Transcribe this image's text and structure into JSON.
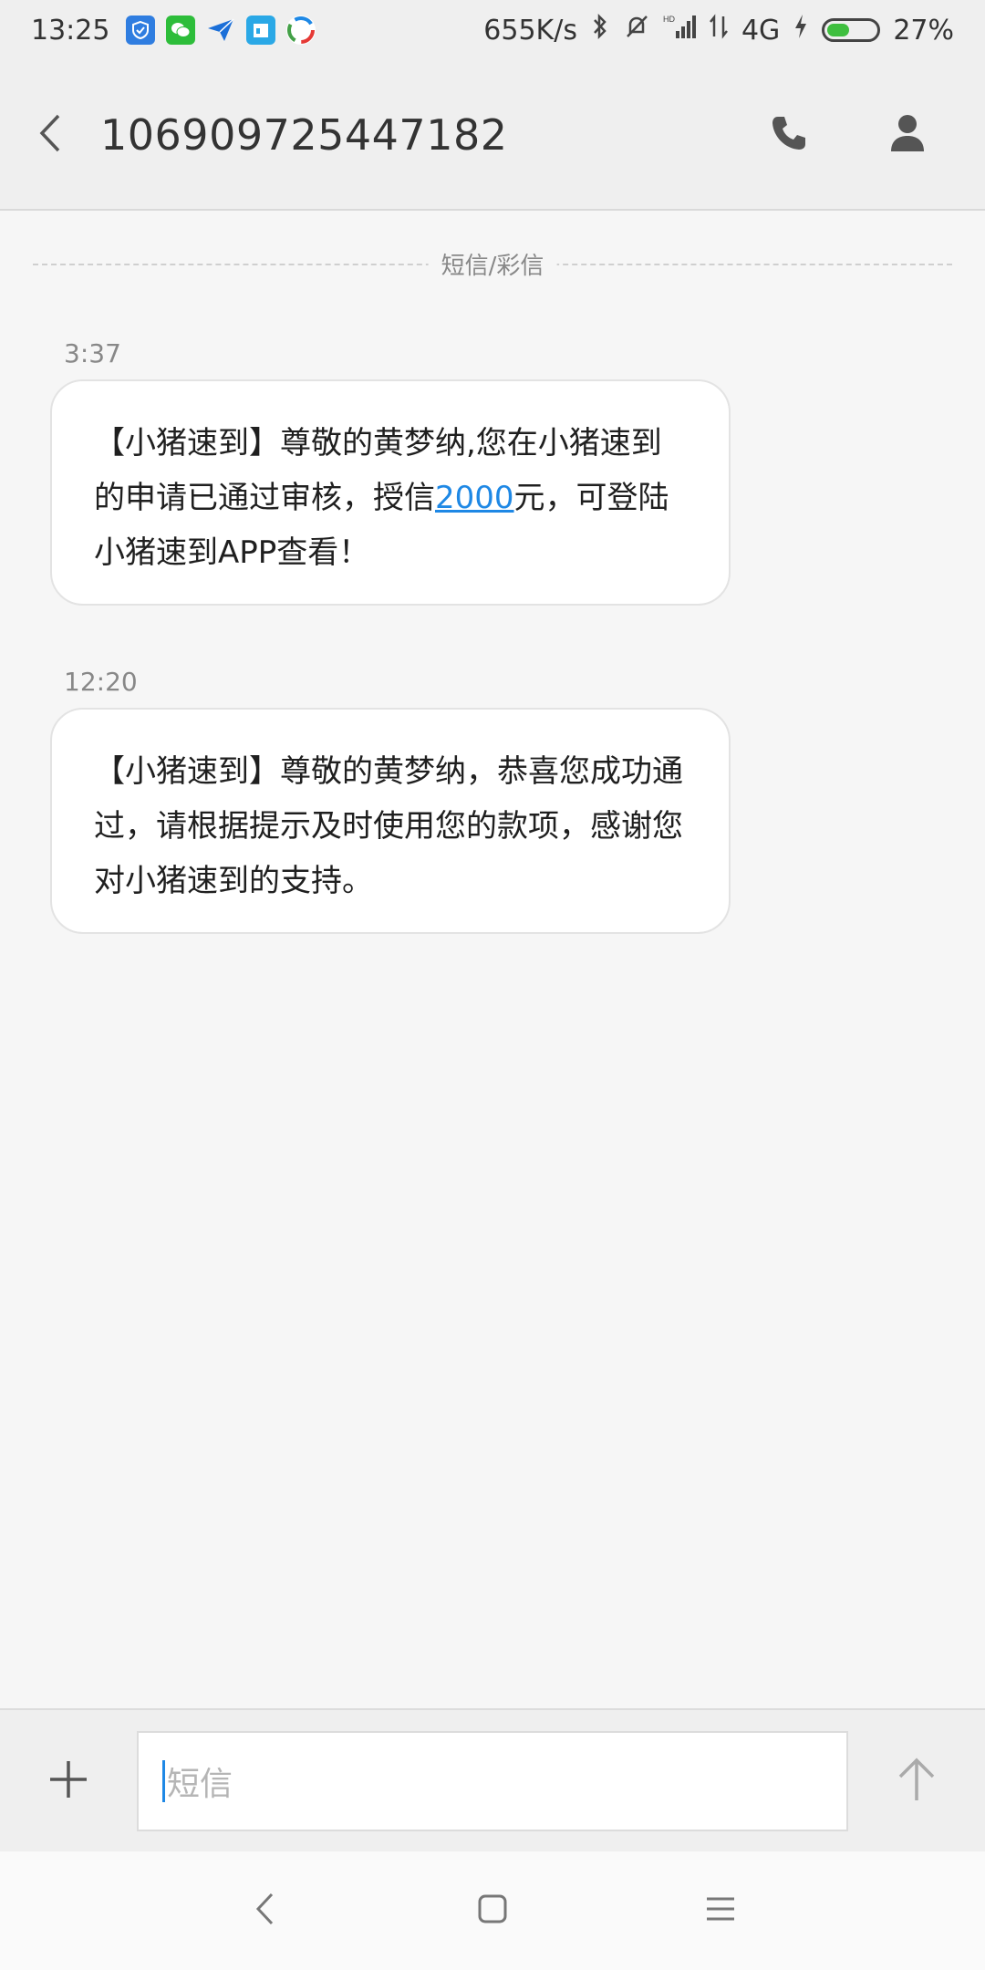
{
  "status_bar": {
    "time": "13:25",
    "network_speed": "655K/s",
    "network_type": "4G",
    "battery": "27%",
    "battery_level": 0.27
  },
  "header": {
    "title": "106909725447182"
  },
  "conversation": {
    "divider_label": "短信/彩信",
    "messages": [
      {
        "time": "3:37",
        "text_before": "【小猪速到】尊敬的黄梦纳,您在小猪速到的申请已通过审核，授信",
        "link": "2000",
        "text_after": "元，可登陆小猪速到APP查看！"
      },
      {
        "time": "12:20",
        "text": "【小猪速到】尊敬的黄梦纳，恭喜您成功通过，请根据提示及时使用您的款项，感谢您对小猪速到的支持。"
      }
    ]
  },
  "composer": {
    "placeholder": "短信"
  },
  "colors": {
    "accent": "#1e88e5",
    "battery_fill": "#3fbf3f"
  },
  "icons": {
    "status": [
      "shield-icon",
      "wechat-icon",
      "bird-icon",
      "calendar-icon",
      "browser-icon",
      "bluetooth-icon",
      "mute-bell-icon",
      "signal-icon",
      "data-arrows-icon",
      "charging-icon"
    ],
    "header": [
      "back-arrow-icon",
      "phone-icon",
      "contact-icon"
    ],
    "composer": [
      "plus-icon",
      "send-arrow-icon"
    ],
    "nav": [
      "nav-back-icon",
      "nav-home-icon",
      "nav-menu-icon"
    ]
  }
}
